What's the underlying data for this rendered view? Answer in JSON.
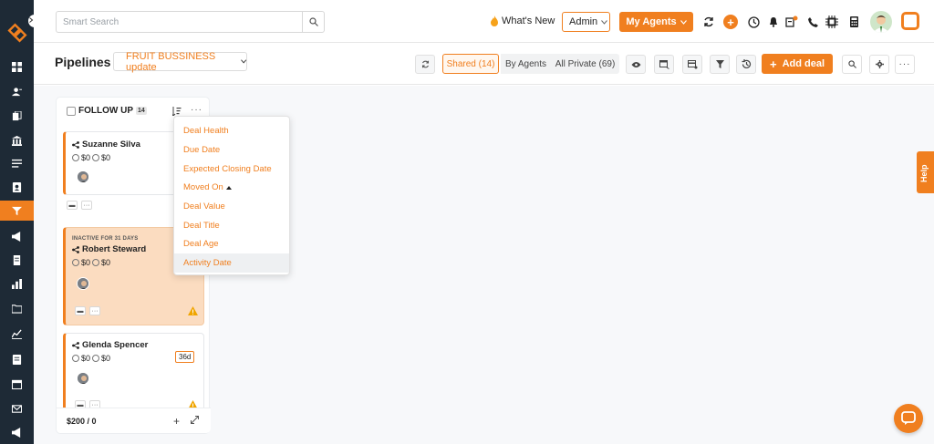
{
  "header": {
    "search_placeholder": "Smart Search",
    "whats_new": "What's New",
    "role_select": "Admin",
    "my_agents": "My Agents",
    "notification_dot_color": "#f07f1f"
  },
  "subheader": {
    "title": "Pipelines",
    "pipeline_select": "FRUIT BUSSINESS update",
    "filters": {
      "shared": "Shared (14)",
      "by_agents": "By Agents",
      "all_private": "All Private (69)"
    },
    "add_deal": "Add deal"
  },
  "column": {
    "title": "FOLLOW UP",
    "count": "14",
    "footer_total": "$200 / 0",
    "cards": [
      {
        "name": "Suzanne Silva",
        "amount1": "$0",
        "amount2": "$0",
        "inactive_label": "",
        "days": "",
        "warning": false
      },
      {
        "name": "Robert Steward",
        "amount1": "$0",
        "amount2": "$0",
        "inactive_label": "INACTIVE FOR 31 DAYS",
        "days": "",
        "warning": true
      },
      {
        "name": "Glenda Spencer",
        "amount1": "$0",
        "amount2": "$0",
        "inactive_label": "",
        "days": "36d",
        "warning": true
      }
    ]
  },
  "sort_menu": {
    "options": [
      {
        "label": "Deal Health"
      },
      {
        "label": "Due Date"
      },
      {
        "label": "Expected Closing Date"
      },
      {
        "label": "Moved On"
      },
      {
        "label": "Deal Value"
      },
      {
        "label": "Deal Title"
      },
      {
        "label": "Deal Age"
      },
      {
        "label": "Activity Date"
      }
    ],
    "hovered": "Activity Date"
  },
  "help_tab": "Help",
  "colors": {
    "accent": "#f07f1f",
    "sidebar": "#1e2a36",
    "inactive_card": "#fbdcc0"
  },
  "icons": {
    "sidebar": [
      "dashboard-icon",
      "contacts-icon",
      "documents-icon",
      "bank-icon",
      "list-icon",
      "contact-card-icon",
      "pipeline-icon",
      "megaphone-icon",
      "document-icon",
      "reports-icon",
      "folder-icon",
      "analytics-icon",
      "invoice-icon",
      "calendar-icon",
      "mail-icon",
      "campaign-icon"
    ]
  }
}
